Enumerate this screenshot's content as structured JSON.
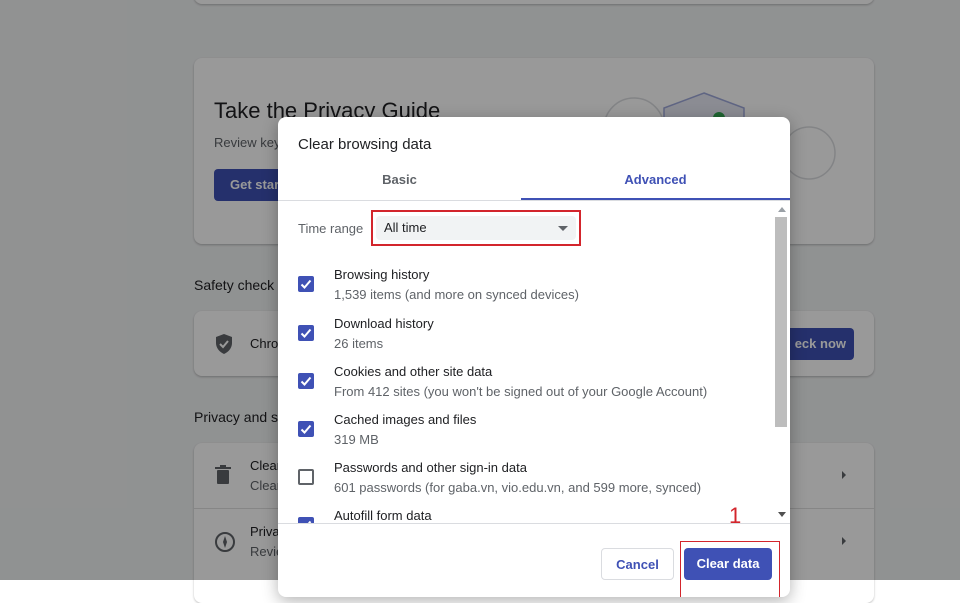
{
  "background": {
    "privacy_guide": {
      "title": "Take the Privacy Guide",
      "subtitle": "Review key",
      "button": "Get star"
    },
    "safety_check": {
      "section_label": "Safety check",
      "row_text": "Chro",
      "button": "eck now"
    },
    "privacy_security": {
      "section_label": "Privacy and s",
      "rows": [
        {
          "title": "Clear",
          "subtitle": "Clear",
          "icon": "trash-icon"
        },
        {
          "title": "Priva",
          "subtitle": "Revie",
          "icon": "compass-icon"
        }
      ]
    }
  },
  "dialog": {
    "title": "Clear browsing data",
    "tabs": [
      {
        "label": "Basic",
        "selected": false
      },
      {
        "label": "Advanced",
        "selected": true
      }
    ],
    "time_range": {
      "label": "Time range",
      "value": "All time"
    },
    "items": [
      {
        "title": "Browsing history",
        "subtitle": "1,539 items (and more on synced devices)",
        "checked": true
      },
      {
        "title": "Download history",
        "subtitle": "26 items",
        "checked": true
      },
      {
        "title": "Cookies and other site data",
        "subtitle": "From 412 sites (you won't be signed out of your Google Account)",
        "checked": true
      },
      {
        "title": "Cached images and files",
        "subtitle": "319 MB",
        "checked": true
      },
      {
        "title": "Passwords and other sign-in data",
        "subtitle": "601 passwords (for gaba.vn, vio.edu.vn, and 599 more, synced)",
        "checked": false
      },
      {
        "title": "Autofill form data",
        "subtitle": "",
        "checked": true
      }
    ],
    "buttons": {
      "cancel": "Cancel",
      "clear": "Clear data"
    }
  },
  "annotation": {
    "step_number": "1",
    "color": "#d3252c"
  },
  "colors": {
    "accent": "#3f51b5",
    "highlight": "#d3252c"
  }
}
